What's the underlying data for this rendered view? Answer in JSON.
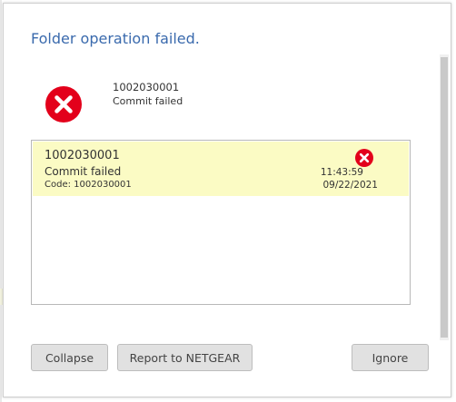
{
  "dialog": {
    "title": "Folder operation failed."
  },
  "summary": {
    "icon": "error-circle-x-icon",
    "id": "1002030001",
    "message": "Commit failed"
  },
  "details": {
    "rows": [
      {
        "id": "1002030001",
        "message": "Commit failed",
        "code": "Code: 1002030001",
        "icon": "error-circle-x-icon",
        "time": "11:43:59",
        "date": "09/22/2021"
      }
    ]
  },
  "buttons": {
    "collapse": "Collapse",
    "report": "Report to NETGEAR",
    "ignore": "Ignore"
  },
  "colors": {
    "title": "#3a6aad",
    "error_icon": "#e3001b",
    "row_highlight": "#fbfbc4"
  }
}
